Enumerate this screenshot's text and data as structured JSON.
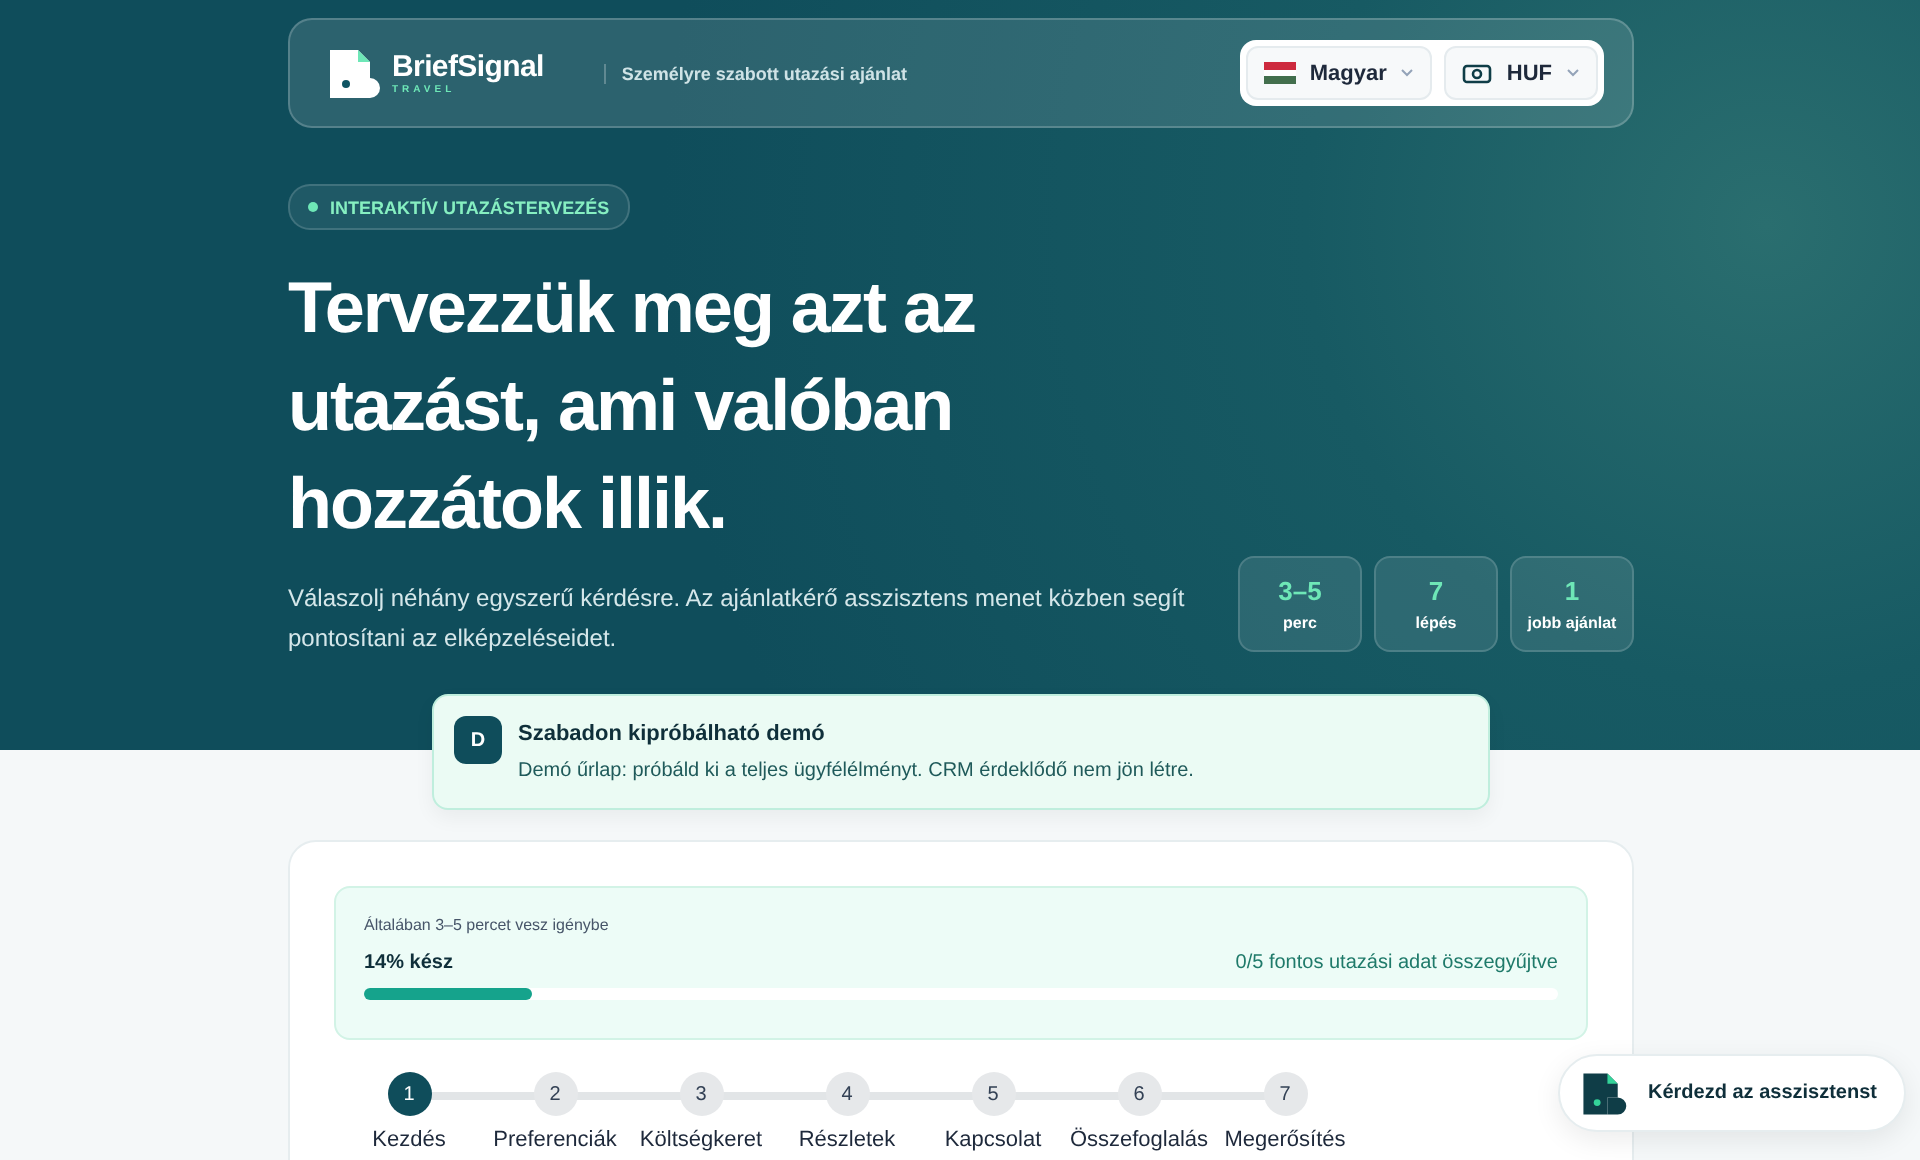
{
  "header": {
    "brand": "BriefSignal",
    "brand_sub": "TRAVEL",
    "tagline": "Személyre szabott utazási ajánlat",
    "language": "Magyar",
    "currency": "HUF"
  },
  "hero": {
    "badge": "INTERAKTÍV UTAZÁSTERVEZÉS",
    "headline": "Tervezzük meg azt az utazást, ami valóban hozzátok illik.",
    "intro": "Válaszolj néhány egyszerű kérdésre. Az ajánlatkérő asszisztens menet közben segít pontosítani az elképzeléseidet.",
    "stats": [
      {
        "value": "3–5",
        "label": "perc"
      },
      {
        "value": "7",
        "label": "lépés"
      },
      {
        "value": "1",
        "label": "jobb ajánlat"
      }
    ]
  },
  "demo_notice": {
    "letter": "D",
    "title": "Szabadon kipróbálható demó",
    "text": "Demó űrlap: próbáld ki a teljes ügyfélélményt. CRM érdeklődő nem jön létre."
  },
  "progress": {
    "hint": "Általában 3–5 percet vesz igénybe",
    "percent_label": "14% kész",
    "collected": "0/5 fontos utazási adat összegyűjtve",
    "level": 0.14
  },
  "steps": [
    {
      "number": "1",
      "label": "Kezdés",
      "selected": true
    },
    {
      "number": "2",
      "label": "Preferenciák",
      "selected": false
    },
    {
      "number": "3",
      "label": "Költségkeret",
      "selected": false
    },
    {
      "number": "4",
      "label": "Részletek",
      "selected": false
    },
    {
      "number": "5",
      "label": "Kapcsolat",
      "selected": false
    },
    {
      "number": "6",
      "label": "Összefoglalás",
      "selected": false
    },
    {
      "number": "7",
      "label": "Megerősítés",
      "selected": false
    }
  ],
  "assistant_button": "Kérdezd az asszisztenst"
}
